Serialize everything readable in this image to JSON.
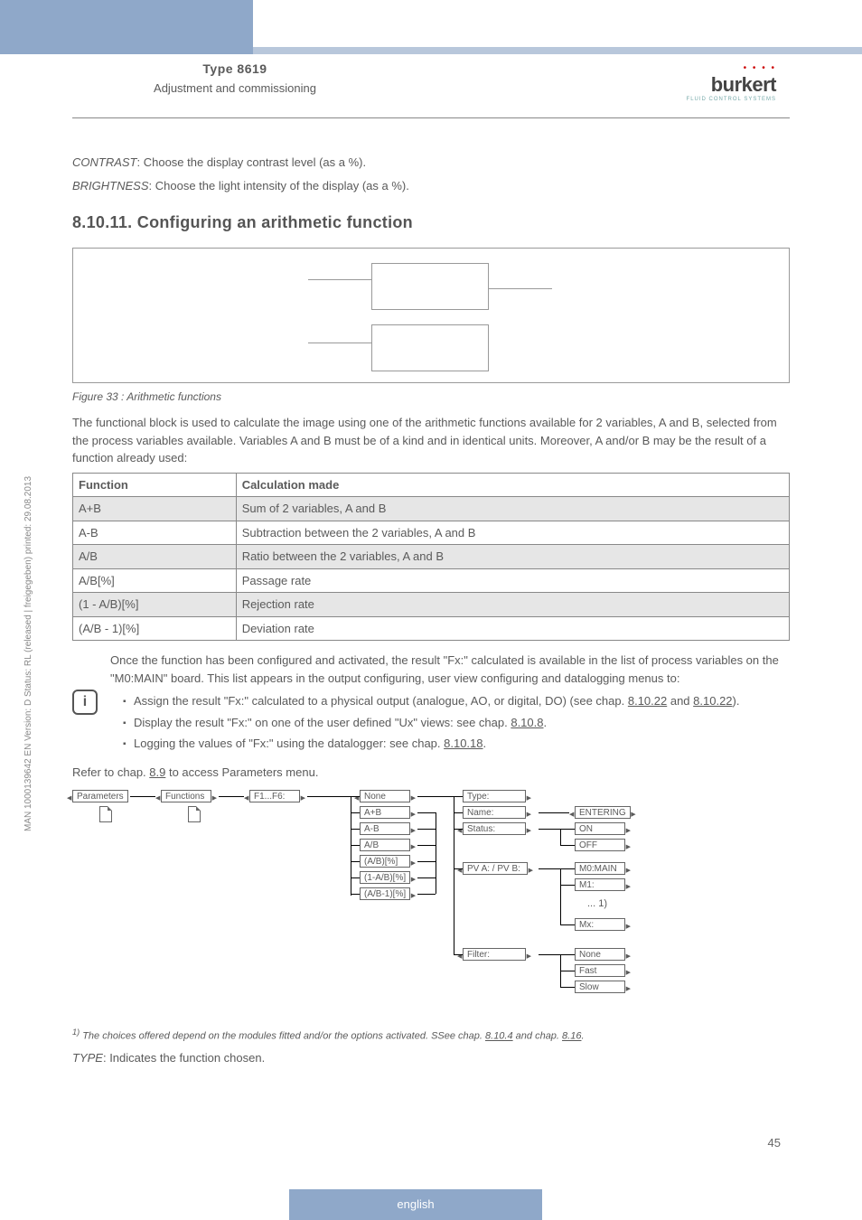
{
  "header": {
    "type_label": "Type 8619",
    "subtitle": "Adjustment and commissioning",
    "logo_name": "burkert",
    "logo_tag": "FLUID CONTROL SYSTEMS"
  },
  "intro": {
    "contrast_label": "CONTRAST",
    "contrast_text": ": Choose the display contrast level (as a %).",
    "brightness_label": "BRIGHTNESS",
    "brightness_text": ": Choose the light intensity of the display (as a %)."
  },
  "section": {
    "number": "8.10.11.",
    "title": "Configuring an arithmetic function"
  },
  "figure": {
    "caption": "Figure 33 :    Arithmetic functions"
  },
  "body": {
    "para1": "The functional block is used to calculate the image using one of the arithmetic functions available for 2 variables, A and B, selected from the process variables available. Variables A and B must be of a kind and in identical units. Moreover, A and/or B may be the result of a function already used:"
  },
  "table": {
    "h1": "Function",
    "h2": "Calculation made",
    "rows": [
      {
        "f": "A+B",
        "c": "Sum of 2 variables, A and B"
      },
      {
        "f": "A-B",
        "c": "Subtraction between the 2 variables, A and B"
      },
      {
        "f": "A/B",
        "c": "Ratio between the 2 variables, A and B"
      },
      {
        "f": "A/B[%]",
        "c": "Passage rate"
      },
      {
        "f": "(1 - A/B)[%]",
        "c": "Rejection rate"
      },
      {
        "f": "(A/B - 1)[%]",
        "c": "Deviation rate"
      }
    ]
  },
  "note": {
    "lead": "Once the function has been configured and activated, the result \"Fx:\" calculated is available in the list of process variables on the \"M0:MAIN\" board. This list appears in the output configuring, user view configuring and datalogging menus to:",
    "b1a": "Assign the result \"Fx:\" calculated to a physical output (analogue, AO, or digital, DO) (see chap. ",
    "b1link1": "8.10.22",
    "b1mid": " and ",
    "b1link2": "8.10.22",
    "b1end": ").",
    "b2a": "Display the result \"Fx:\" on one of the user defined \"Ux\" views: see chap. ",
    "b2link": "8.10.8",
    "b2end": ".",
    "b3a": "Logging the values of \"Fx:\" using the datalogger: see chap. ",
    "b3link": "8.10.18",
    "b3end": "."
  },
  "refer": {
    "pre": "Refer to chap. ",
    "link": "8.9",
    "post": " to access Parameters menu."
  },
  "tree": {
    "parameters": "Parameters",
    "functions": "Functions",
    "f1f6": "F1...F6:",
    "none": "None",
    "aplusb": "A+B",
    "aminusb": "A-B",
    "adivb": "A/B",
    "abpct": "(A/B)[%]",
    "oneminus": "(1-A/B)[%]",
    "abminus1": "(A/B-1)[%]",
    "type": "Type:",
    "name": "Name:",
    "status": "Status:",
    "entering": "ENTERING",
    "on": "ON",
    "off": "OFF",
    "pvab": "PV A: / PV B:",
    "m0": "M0:MAIN",
    "m1": "M1:",
    "dots": "... 1)",
    "mx": "Mx:",
    "filter": "Filter:",
    "fnone": "None",
    "fast": "Fast",
    "slow": "Slow"
  },
  "footnote": {
    "sup": "1)",
    "text": " The choices offered depend on the modules fitted and/or the options activated. SSee chap. ",
    "link1": "8.10.4",
    "mid": " and chap. ",
    "link2": "8.16",
    "end": "."
  },
  "last": {
    "label": "TYPE",
    "text": ": Indicates the function chosen."
  },
  "side": "MAN 1000139642 EN Version: D Status: RL (released | freigegeben) printed: 29.08.2013",
  "page": "45",
  "footer": "english"
}
